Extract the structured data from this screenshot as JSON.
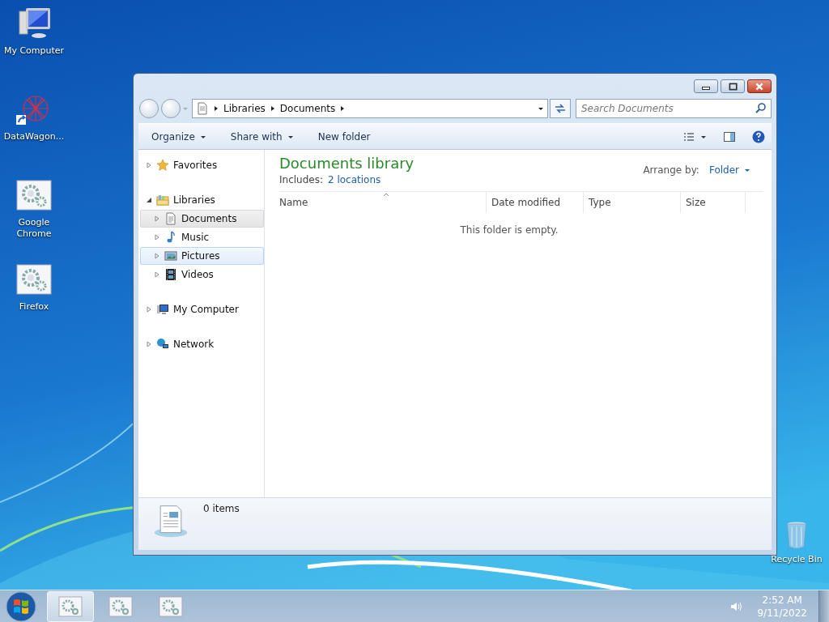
{
  "desktop_icons": [
    {
      "label": "My Computer",
      "kind": "computer"
    },
    {
      "label": "DataWagon...",
      "kind": "shortcut"
    },
    {
      "label": "Google Chrome",
      "kind": "app"
    },
    {
      "label": "Firefox",
      "kind": "app"
    },
    {
      "label": "Recycle Bin",
      "kind": "bin"
    }
  ],
  "window": {
    "address": [
      "Libraries",
      "Documents"
    ],
    "search": {
      "placeholder": "Search Documents"
    },
    "toolbar": [
      {
        "label": "Organize",
        "dropdown": true
      },
      {
        "label": "Share with",
        "dropdown": true
      },
      {
        "label": "New folder",
        "dropdown": false
      }
    ],
    "nav": [
      {
        "label": "Favorites",
        "kind": "star",
        "expanded": false,
        "selected": false,
        "hovered": false
      },
      {
        "label": "Libraries",
        "kind": "library",
        "expanded": true,
        "selected": false,
        "hovered": false,
        "children": [
          {
            "label": "Documents",
            "kind": "document",
            "expanded": false,
            "selected": true,
            "hovered": false
          },
          {
            "label": "Music",
            "kind": "music",
            "expanded": false,
            "selected": false,
            "hovered": false
          },
          {
            "label": "Pictures",
            "kind": "pictures",
            "expanded": false,
            "selected": false,
            "hovered": true
          },
          {
            "label": "Videos",
            "kind": "videos",
            "expanded": false,
            "selected": false,
            "hovered": false
          }
        ]
      },
      {
        "label": "My Computer",
        "kind": "computer",
        "expanded": false,
        "selected": false,
        "hovered": false
      },
      {
        "label": "Network",
        "kind": "network",
        "expanded": false,
        "selected": false,
        "hovered": false
      }
    ],
    "library": {
      "title": "Documents library",
      "includes_label": "Includes:",
      "includes_link": "2 locations",
      "arrange_label": "Arrange by:",
      "arrange_value": "Folder"
    },
    "columns": [
      {
        "label": "Name",
        "sorted": true
      },
      {
        "label": "Date modified",
        "sorted": false
      },
      {
        "label": "Type",
        "sorted": false
      },
      {
        "label": "Size",
        "sorted": false
      }
    ],
    "empty_message": "This folder is empty.",
    "status": "0 items"
  },
  "taskbar": {
    "buttons": [
      {
        "selected": true
      },
      {
        "selected": false
      },
      {
        "selected": false
      }
    ],
    "time": "2:52 AM",
    "date": "9/11/2022"
  }
}
